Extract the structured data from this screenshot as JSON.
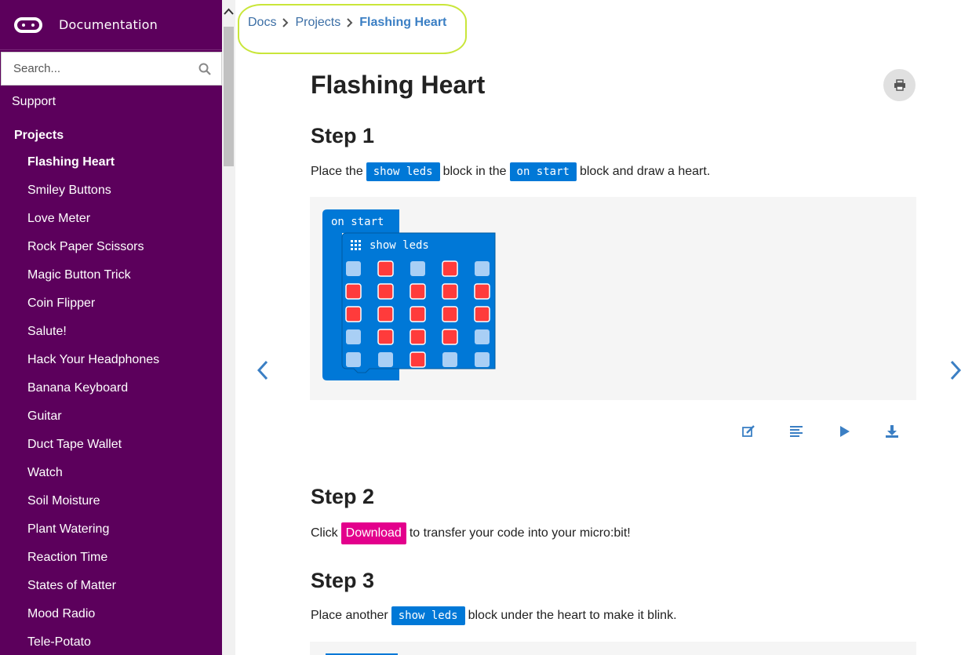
{
  "sidebar": {
    "title": "Documentation",
    "search_placeholder": "Search...",
    "support": "Support",
    "section": "Projects",
    "items": [
      "Flashing Heart",
      "Smiley Buttons",
      "Love Meter",
      "Rock Paper Scissors",
      "Magic Button Trick",
      "Coin Flipper",
      "Salute!",
      "Hack Your Headphones",
      "Banana Keyboard",
      "Guitar",
      "Duct Tape Wallet",
      "Watch",
      "Soil Moisture",
      "Plant Watering",
      "Reaction Time",
      "States of Matter",
      "Mood Radio",
      "Tele-Potato"
    ],
    "active_item": "Flashing Heart"
  },
  "breadcrumb": {
    "docs": "Docs",
    "projects": "Projects",
    "current": "Flashing Heart"
  },
  "page": {
    "title": "Flashing Heart"
  },
  "step1": {
    "heading": "Step 1",
    "t1": "Place the",
    "chip1": "show leds",
    "t2": "block in the",
    "chip2": "on start",
    "t3": "block and draw a heart."
  },
  "blocks": {
    "hat_label": "on start",
    "leds_label": "show leds",
    "grid": [
      [
        0,
        1,
        0,
        1,
        0
      ],
      [
        1,
        1,
        1,
        1,
        1
      ],
      [
        1,
        1,
        1,
        1,
        1
      ],
      [
        0,
        1,
        1,
        1,
        0
      ],
      [
        0,
        0,
        1,
        0,
        0
      ]
    ]
  },
  "step2": {
    "heading": "Step 2",
    "t1": "Click",
    "chip": "Download",
    "t2": "to transfer your code into your micro:bit!"
  },
  "step3": {
    "heading": "Step 3",
    "t1": "Place another",
    "chip": "show leds",
    "t2": "block under the heart to make it blink."
  },
  "colors": {
    "sidebar": "#5c005c",
    "block": "#0078d7",
    "led_on": "#ff3b3b",
    "led_off": "#a9cff5",
    "download": "#e3008c"
  }
}
